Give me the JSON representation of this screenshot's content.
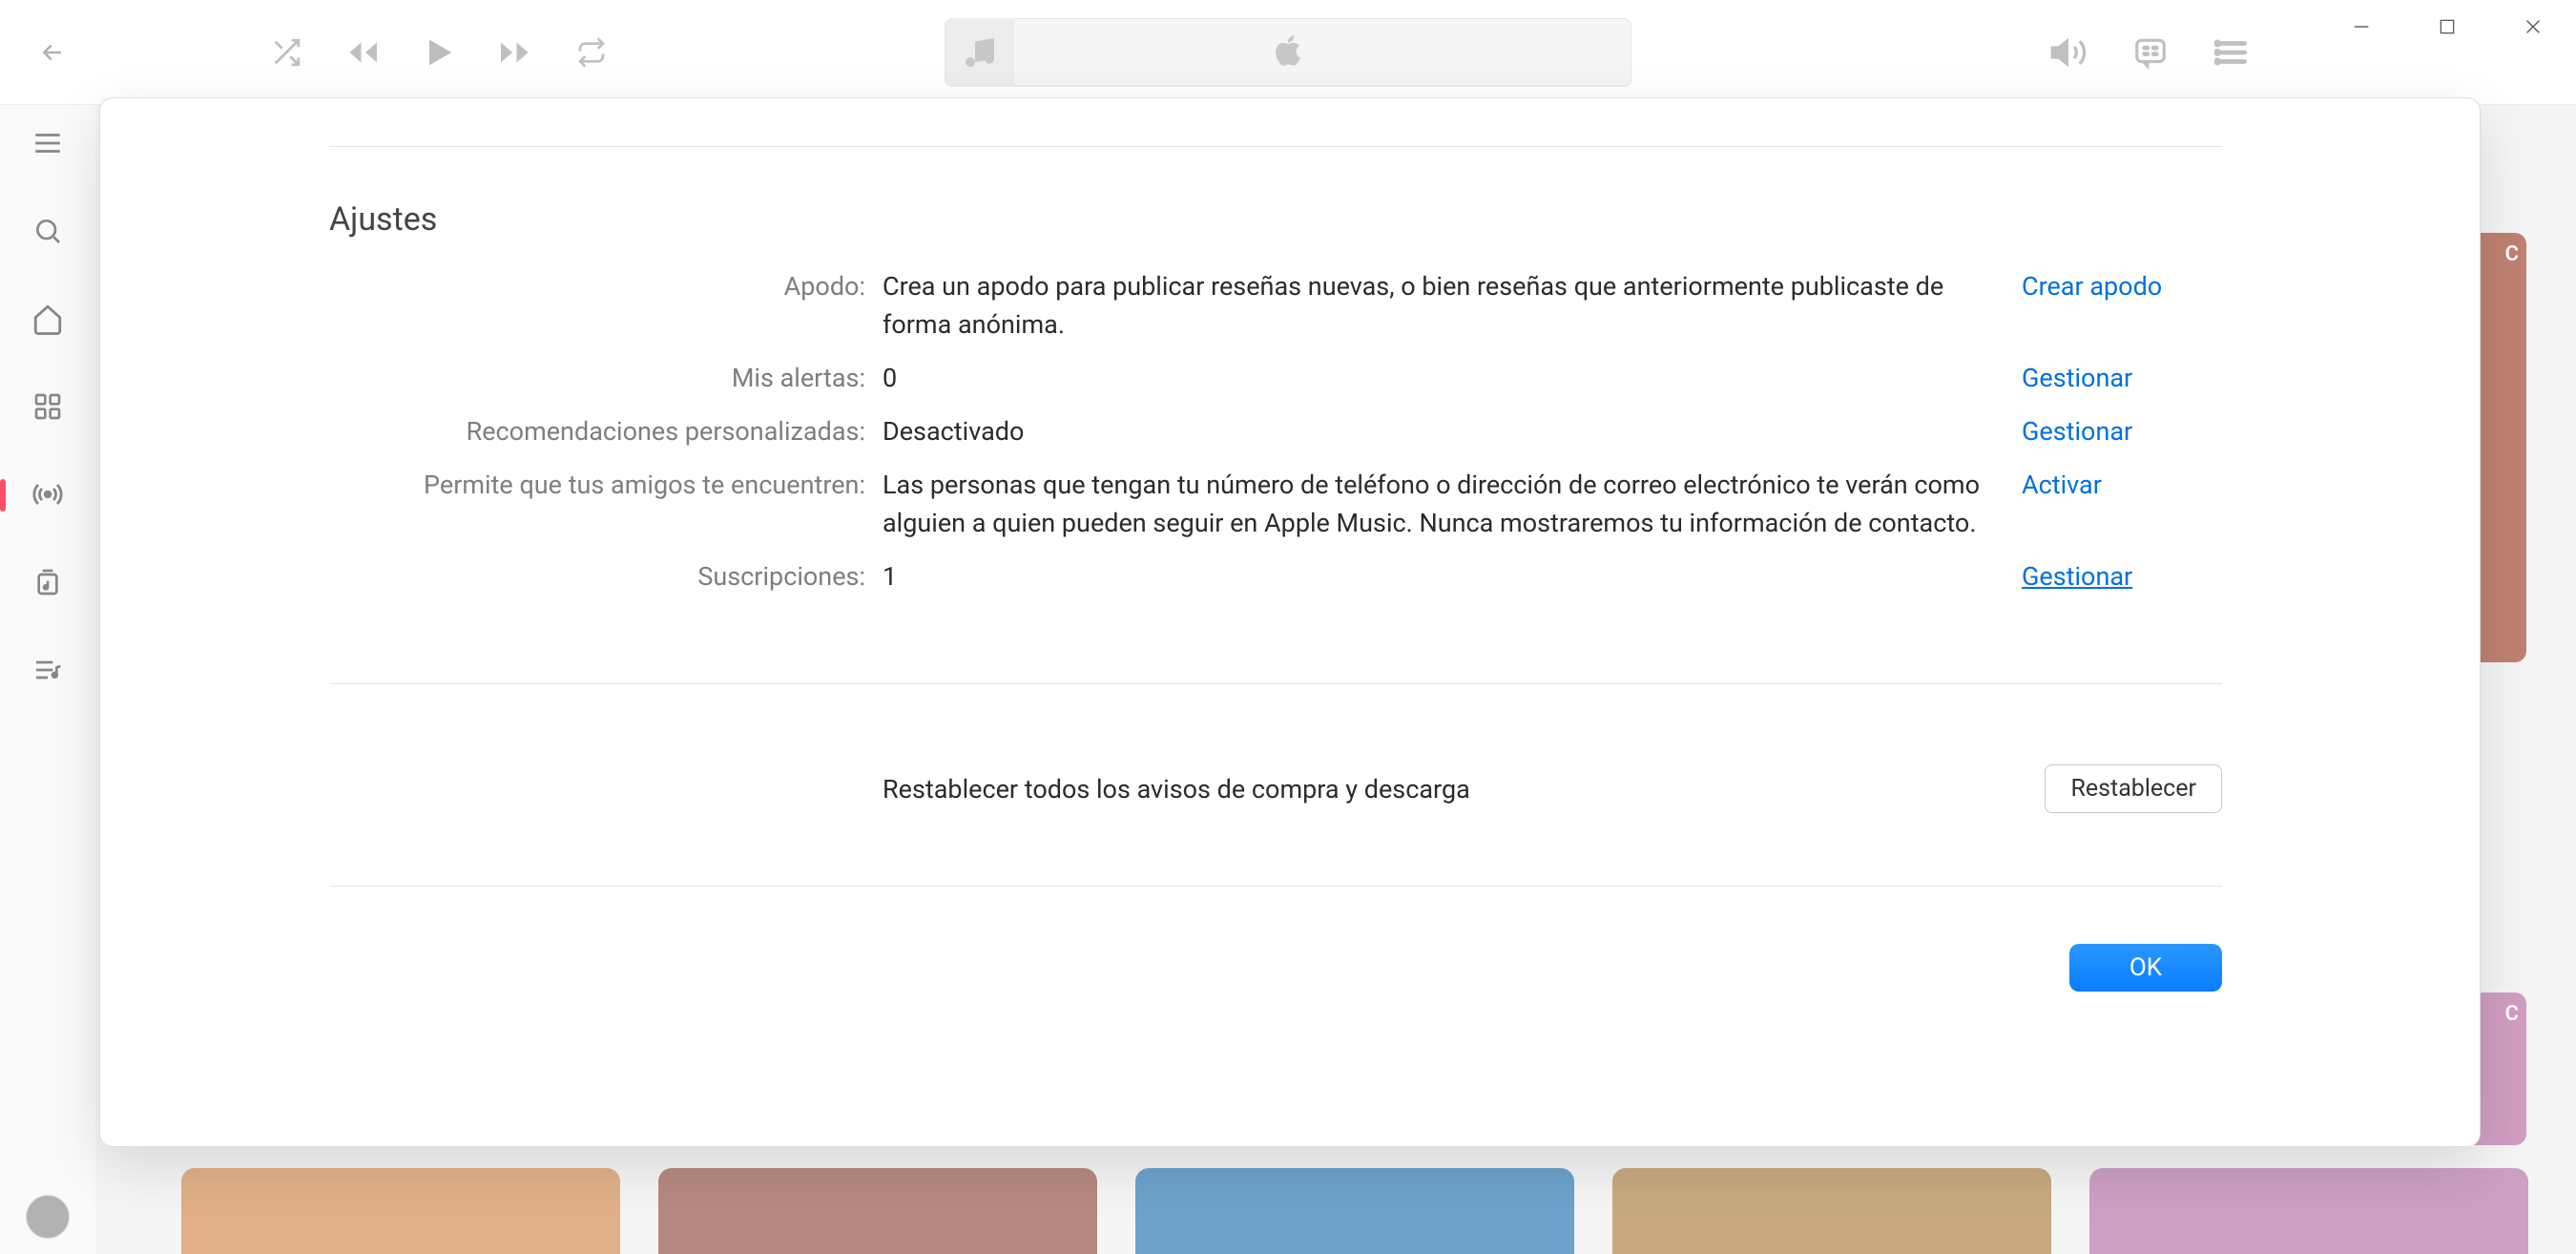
{
  "modal": {
    "title": "Ajustes",
    "rows": {
      "nickname": {
        "label": "Apodo:",
        "value": "Crea un apodo para publicar reseñas nuevas, o bien reseñas que anteriormente publicaste de forma anónima.",
        "action": "Crear apodo"
      },
      "alerts": {
        "label": "Mis alertas:",
        "value": "0",
        "action": "Gestionar"
      },
      "recommendations": {
        "label": "Recomendaciones personalizadas:",
        "value": "Desactivado",
        "action": "Gestionar"
      },
      "findable": {
        "label": "Permite que tus amigos te encuentren:",
        "value": "Las personas que tengan tu número de teléfono o dirección de correo electrónico te verán como alguien a quien pueden seguir en Apple Music. Nunca mostraremos tu información de contacto.",
        "action": "Activar"
      },
      "subscriptions": {
        "label": "Suscripciones:",
        "value": "1",
        "action": "Gestionar"
      }
    },
    "reset": {
      "label": "Restablecer todos los avisos de compra y descarga",
      "button": "Restablecer"
    },
    "ok_button": "OK"
  },
  "bg_badge_text": "C",
  "colors": {
    "tile1": "#e1b088",
    "tile2": "#b68980",
    "tile3": "#6da2cb",
    "tile4": "#c8a97f",
    "tile5": "#cd9fc3"
  }
}
